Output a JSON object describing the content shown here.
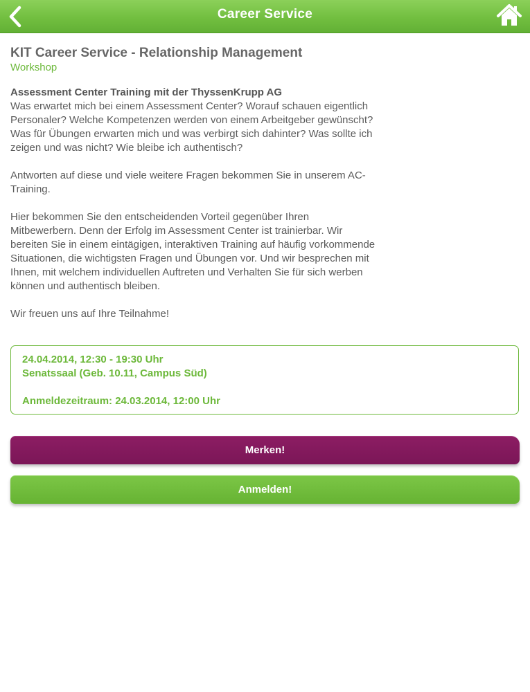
{
  "navbar": {
    "title": "Career Service",
    "back_icon": "chevron-left-icon",
    "home_icon": "home-icon"
  },
  "event": {
    "title": "KIT Career Service - Relationship Management",
    "category": "Workshop",
    "description": {
      "heading": "Assessment Center Training mit der ThyssenKrupp AG",
      "paragraph1": "Was erwartet mich bei einem Assessment Center? Worauf schauen eigentlich Personaler? Welche Kompetenzen werden von einem Arbeitgeber gewünscht? Was für Übungen erwarten mich und was verbirgt sich dahinter? Was sollte ich zeigen und was nicht? Wie bleibe ich authentisch?",
      "paragraph2": "Antworten auf diese und viele weitere Fragen bekommen Sie in unserem AC-Training.",
      "paragraph3": "Hier bekommen Sie den entscheidenden Vorteil gegenüber Ihren Mitbewerbern. Denn der Erfolg im Assessment Center ist trainierbar. Wir bereiten Sie in einem eintägigen, interaktiven Training auf häufig vorkommende Situationen, die wichtigsten Fragen und Übungen vor. Und wir besprechen mit Ihnen, mit welchem individuellen Auftreten und Verhalten Sie für sich werben können und authentisch bleiben.",
      "paragraph4": "Wir freuen uns auf Ihre Teilnahme!"
    },
    "details": {
      "datetime": "24.04.2014, 12:30 - 19:30 Uhr",
      "location": "Senatssaal (Geb. 10.11, Campus Süd)",
      "registration": "Anmeldezeitraum: 24.03.2014, 12:00 Uhr"
    }
  },
  "actions": {
    "bookmark_label": "Merken!",
    "register_label": "Anmelden!"
  },
  "colors": {
    "brand_green": "#6cb83a",
    "bookmark_purple": "#7e1759",
    "text_gray": "#5a5a5a"
  }
}
